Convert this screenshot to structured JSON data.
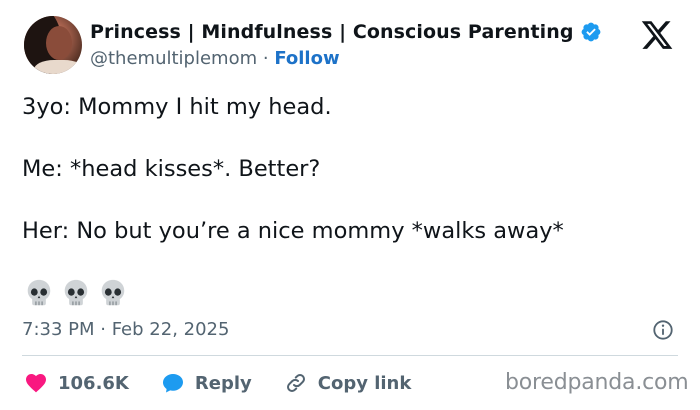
{
  "header": {
    "display_name": "Princess | Mindfulness | Conscious Parenting",
    "handle": "@themultiplemom",
    "separator": "·",
    "follow_label": "Follow"
  },
  "tweet": {
    "lines": [
      "3yo: Mommy I hit my head.",
      "Me: *head kisses*. Better?",
      "Her: No but you’re a nice mommy *walks away*"
    ],
    "emoji": [
      "skull-emoji",
      "skull-emoji",
      "skull-emoji"
    ],
    "timestamp": "7:33 PM · Feb 22, 2025"
  },
  "actions": {
    "likes": "106.6K",
    "reply_label": "Reply",
    "copy_link_label": "Copy link"
  },
  "watermark": "boredpanda.com",
  "colors": {
    "verified": "#1d9bf0",
    "follow": "#1d72c8",
    "heart": "#f91880",
    "reply": "#1d9bf0",
    "muted_text": "#536471"
  }
}
